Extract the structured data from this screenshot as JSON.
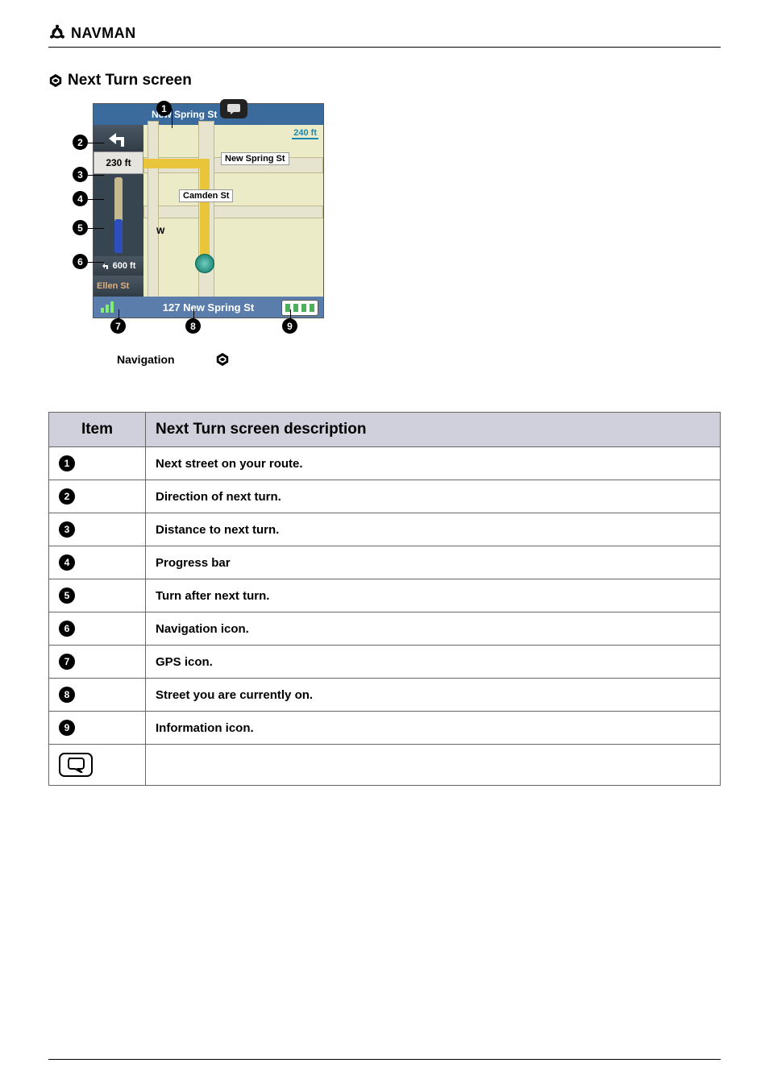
{
  "brand": {
    "name": "NAVMAN"
  },
  "section": {
    "title": "Next Turn screen",
    "nav_label": "Navigation"
  },
  "map": {
    "top_street": "New Spring St",
    "bottom_street": "127 New Spring St",
    "distance_next": "230 ft",
    "distance_after": "600 ft",
    "nav_icon_text": "Ellen St",
    "scale": "240 ft",
    "label_spring": "New Spring St",
    "label_camden": "Camden St",
    "w_marker": "W"
  },
  "table": {
    "header_item": "Item",
    "header_desc": "Next Turn screen description",
    "rows": [
      {
        "num": "1",
        "desc": "Next street on your route."
      },
      {
        "num": "2",
        "desc": "Direction of next turn."
      },
      {
        "num": "3",
        "desc": "Distance to next turn."
      },
      {
        "num": "4",
        "desc": "Progress bar"
      },
      {
        "num": "5",
        "desc": "Turn after next turn."
      },
      {
        "num": "6",
        "desc": "Navigation icon."
      },
      {
        "num": "7",
        "desc": "GPS icon."
      },
      {
        "num": "8",
        "desc": "Street you are currently on."
      },
      {
        "num": "9",
        "desc": "Information icon."
      }
    ]
  },
  "callouts": [
    "1",
    "2",
    "3",
    "4",
    "5",
    "6",
    "7",
    "8",
    "9"
  ]
}
